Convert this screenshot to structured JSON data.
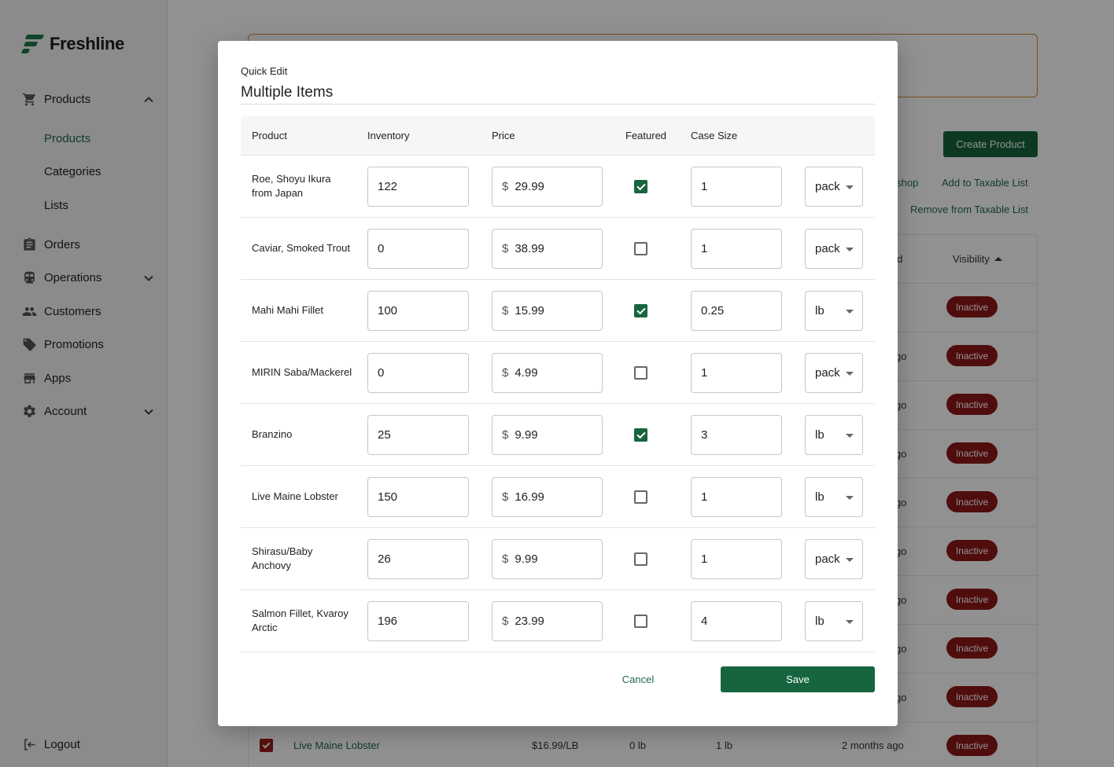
{
  "brand": {
    "name": "Freshline"
  },
  "sidebar": {
    "items": [
      {
        "label": "Products",
        "icon": "cart-icon",
        "expanded": true
      },
      {
        "label": "Orders",
        "icon": "clipboard-icon"
      },
      {
        "label": "Operations",
        "icon": "train-icon",
        "expanded": false
      },
      {
        "label": "Customers",
        "icon": "people-icon"
      },
      {
        "label": "Promotions",
        "icon": "tag-icon"
      },
      {
        "label": "Apps",
        "icon": "store-icon"
      },
      {
        "label": "Account",
        "icon": "gear-icon",
        "expanded": false
      }
    ],
    "sub_items": [
      "Products",
      "Categories",
      "Lists"
    ],
    "active_sub": "Products",
    "logout": "Logout"
  },
  "background": {
    "create_button": "Create Product",
    "link_shop": "shop",
    "link_add_taxable": "Add to Taxable List",
    "link_remove_taxable": "Remove from Taxable List",
    "col_partial": "d",
    "col_visibility": "Visibility",
    "ago_partial": "go",
    "status": "Inactive",
    "last_row": {
      "name": "Live Maine Lobster",
      "price": "$16.99/LB",
      "inventory": "0 lb",
      "case": "1 lb",
      "updated": "2 months ago"
    }
  },
  "modal": {
    "eyebrow": "Quick Edit",
    "title": "Multiple Items",
    "columns": [
      "Product",
      "Inventory",
      "Price",
      "Featured",
      "Case Size"
    ],
    "currency": "$",
    "rows": [
      {
        "product": "Roe, Shoyu Ikura from Japan",
        "inventory": "122",
        "price": "29.99",
        "featured": true,
        "case_size": "1",
        "unit": "pack"
      },
      {
        "product": "Caviar, Smoked Trout",
        "inventory": "0",
        "price": "38.99",
        "featured": false,
        "case_size": "1",
        "unit": "pack"
      },
      {
        "product": "Mahi Mahi Fillet",
        "inventory": "100",
        "price": "15.99",
        "featured": true,
        "case_size": "0.25",
        "unit": "lb"
      },
      {
        "product": "MIRIN Saba/Mackerel",
        "inventory": "0",
        "price": "4.99",
        "featured": false,
        "case_size": "1",
        "unit": "pack"
      },
      {
        "product": "Branzino",
        "inventory": "25",
        "price": "9.99",
        "featured": true,
        "case_size": "3",
        "unit": "lb"
      },
      {
        "product": "Live Maine Lobster",
        "inventory": "150",
        "price": "16.99",
        "featured": false,
        "case_size": "1",
        "unit": "lb"
      },
      {
        "product": "Shirasu/Baby Anchovy",
        "inventory": "26",
        "price": "9.99",
        "featured": false,
        "case_size": "1",
        "unit": "pack"
      },
      {
        "product": "Salmon Fillet, Kvaroy Arctic",
        "inventory": "196",
        "price": "23.99",
        "featured": false,
        "case_size": "4",
        "unit": "lb"
      }
    ],
    "cancel": "Cancel",
    "save": "Save"
  },
  "colors": {
    "brand_green": "#17653f",
    "status_red": "#8e1818",
    "warning_border": "#d48a2e"
  }
}
